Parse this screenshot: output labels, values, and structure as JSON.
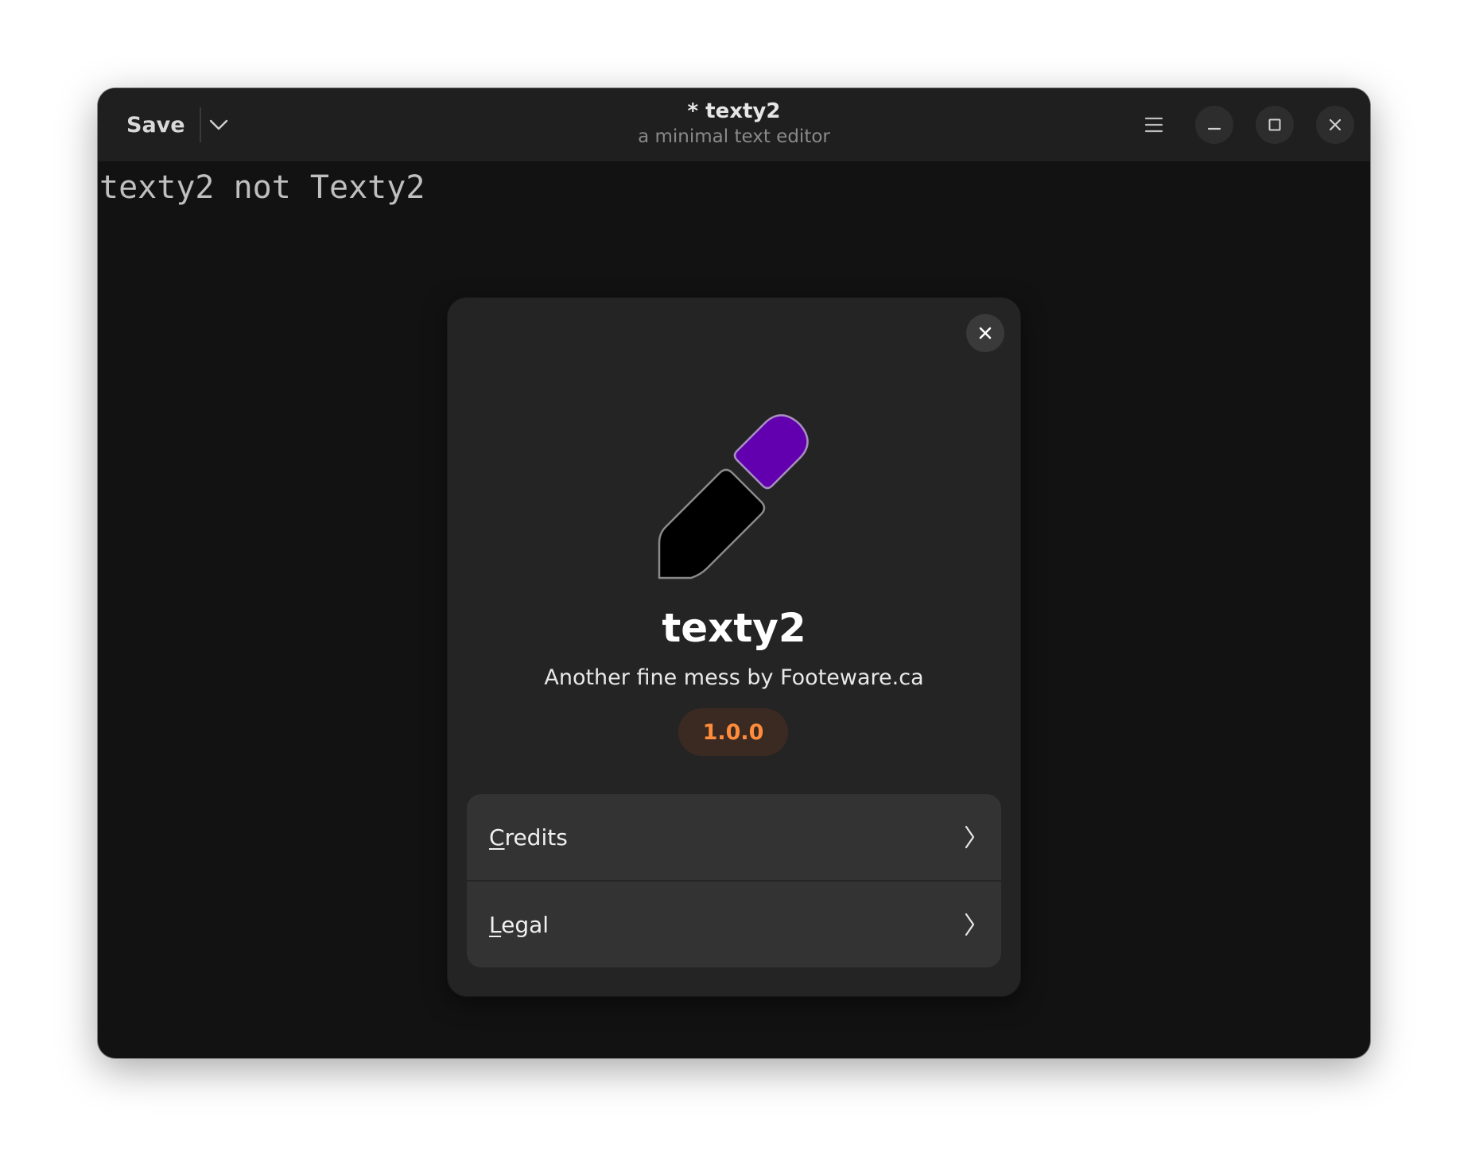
{
  "headerbar": {
    "save_label": "Save",
    "title": "* texty2",
    "subtitle": "a minimal text editor",
    "icons": {
      "save_menu": "chevron-down-icon",
      "main_menu": "hamburger-menu-icon",
      "minimize": "minimize-icon",
      "maximize": "maximize-icon",
      "close": "close-icon"
    }
  },
  "editor": {
    "content": "texty2 not Texty2"
  },
  "about_dialog": {
    "close_icon": "close-icon",
    "app_icon": "pen-icon",
    "app_name": "texty2",
    "developer": "Another fine mess by Footeware.ca",
    "version": "1.0.0",
    "rows": [
      {
        "mnemonic": "C",
        "rest": "redits",
        "label": "Credits",
        "icon": "chevron-right-icon"
      },
      {
        "mnemonic": "L",
        "rest": "egal",
        "label": "Legal",
        "icon": "chevron-right-icon"
      }
    ]
  },
  "colors": {
    "window_bg": "#121212",
    "headerbar_bg": "#1f1f1f",
    "dialog_bg": "#242424",
    "version_text": "#ff8c3a",
    "version_bg": "#3b2a22",
    "icon_cap": "#6200b0",
    "icon_body": "#000000"
  }
}
